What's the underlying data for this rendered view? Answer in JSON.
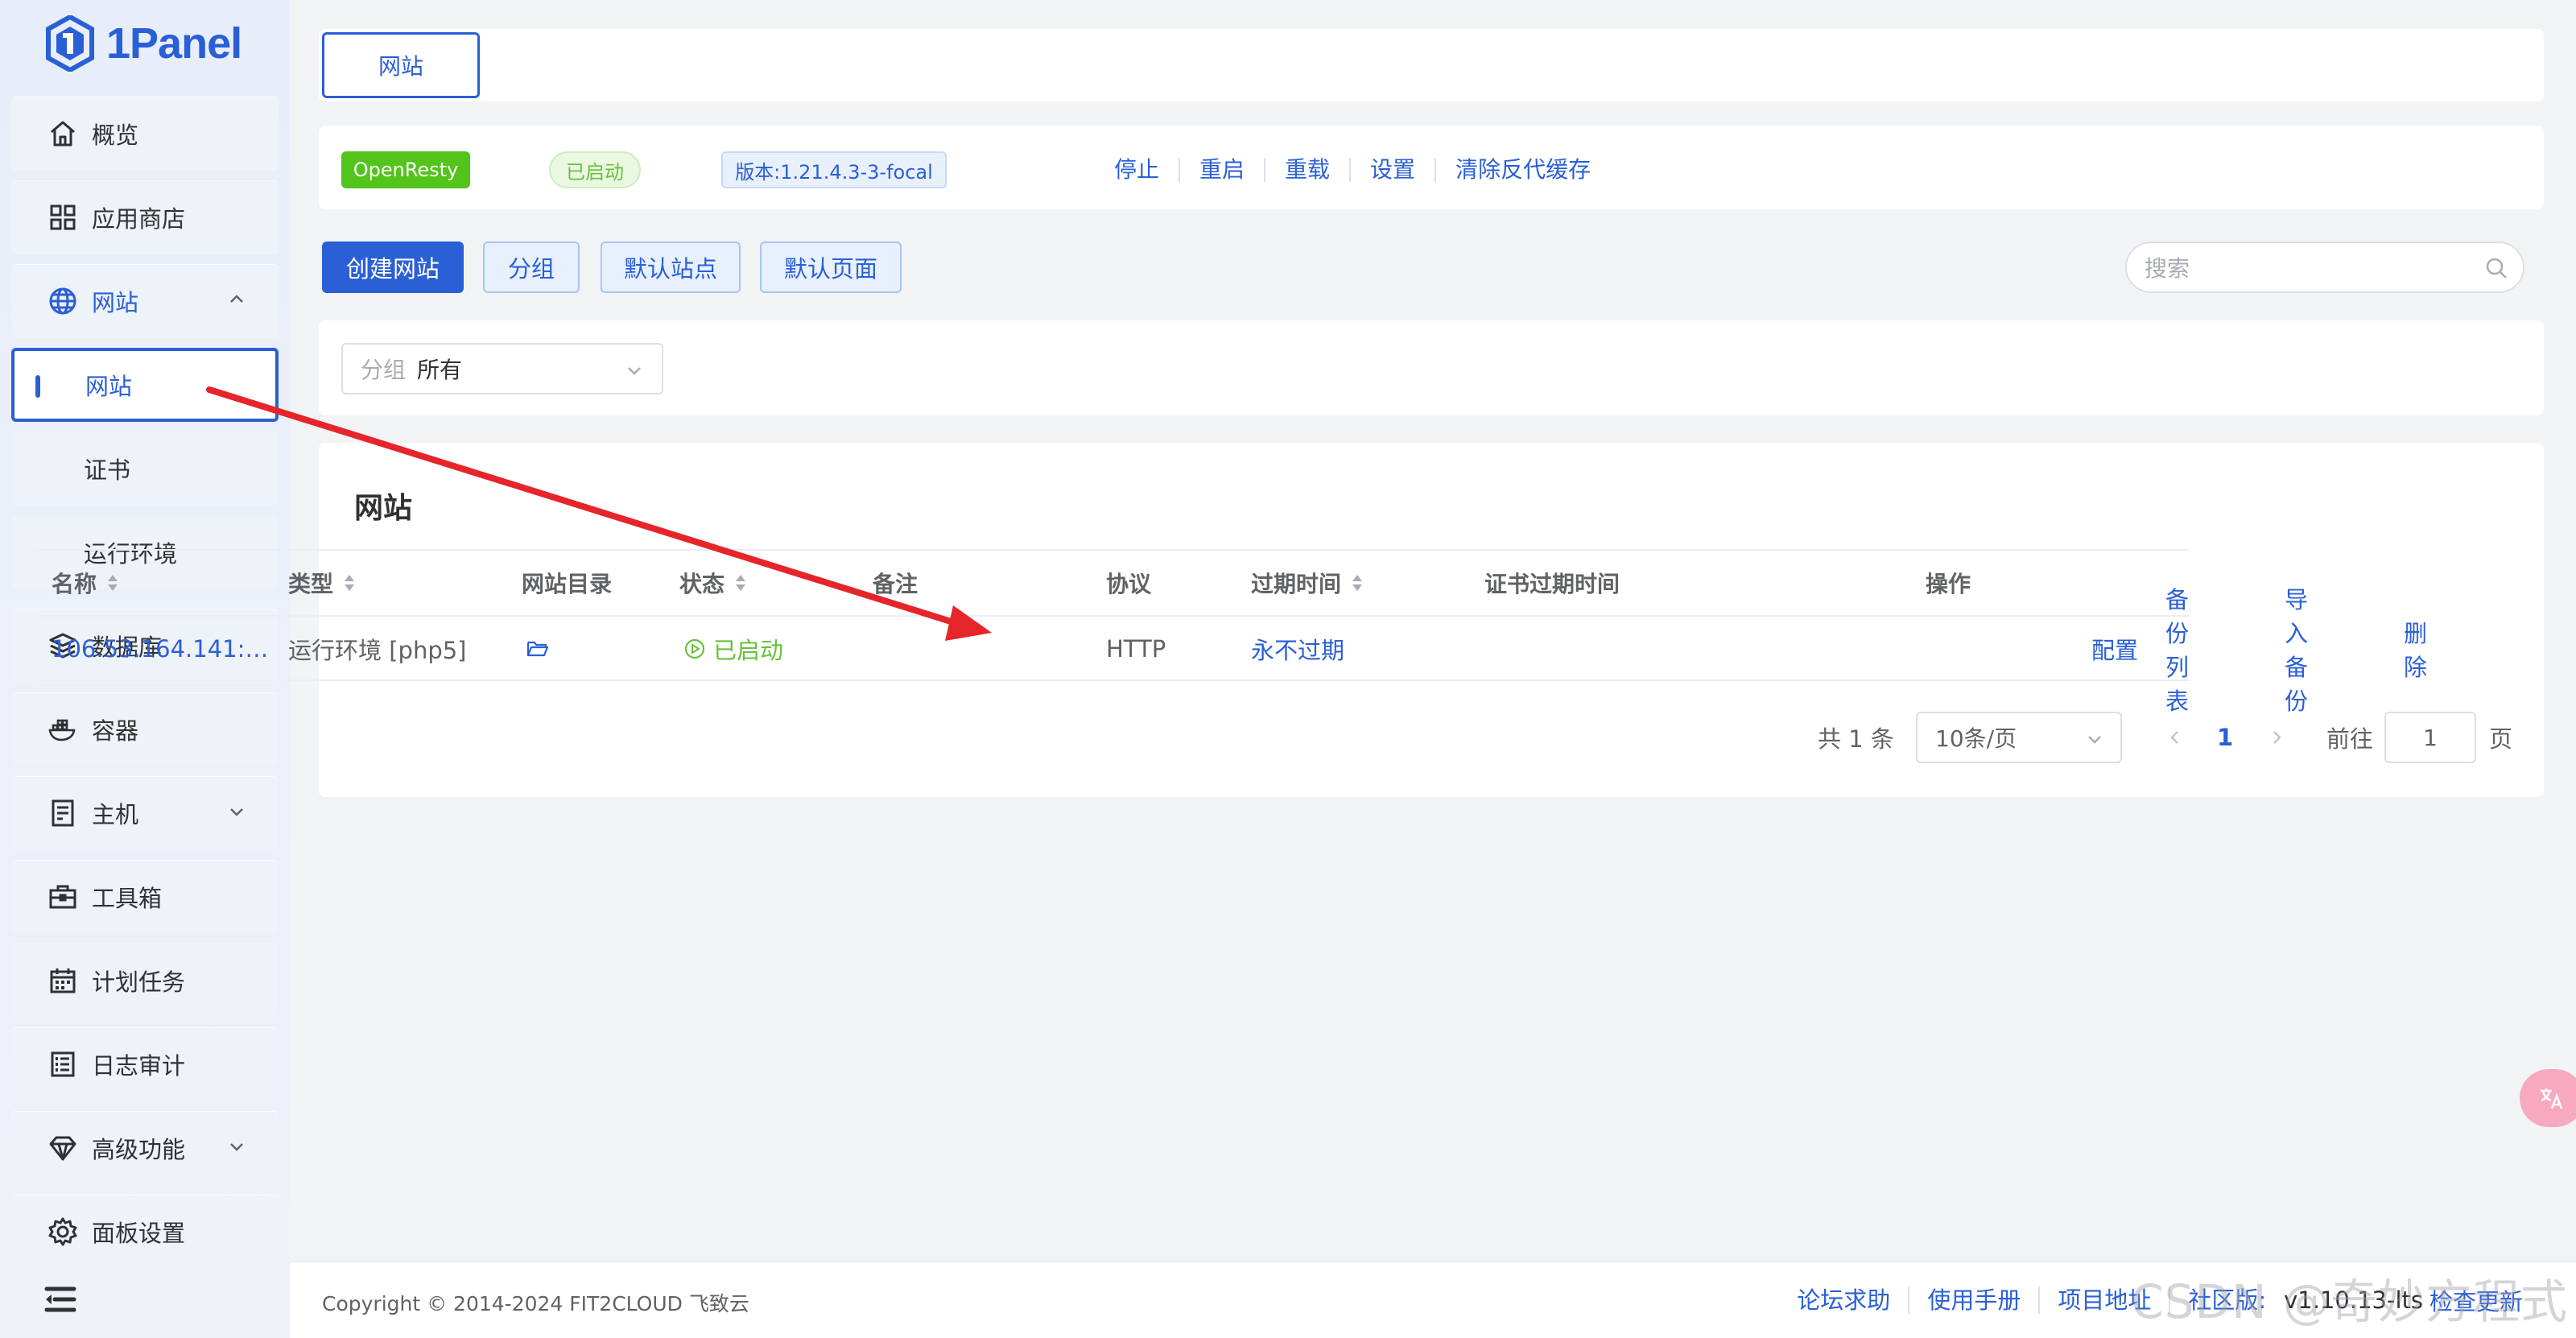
{
  "app": {
    "name": "1Panel"
  },
  "sidebar": {
    "items": [
      {
        "label": "概览",
        "icon": "home-icon"
      },
      {
        "label": "应用商店",
        "icon": "grid-icon"
      },
      {
        "label": "网站",
        "icon": "globe-icon",
        "expanded": true
      },
      {
        "label": "数据库",
        "icon": "layers-icon"
      },
      {
        "label": "容器",
        "icon": "docker-icon"
      },
      {
        "label": "主机",
        "icon": "server-icon"
      },
      {
        "label": "工具箱",
        "icon": "toolbox-icon"
      },
      {
        "label": "计划任务",
        "icon": "calendar-icon"
      },
      {
        "label": "日志审计",
        "icon": "log-icon"
      },
      {
        "label": "高级功能",
        "icon": "diamond-icon"
      },
      {
        "label": "面板设置",
        "icon": "gear-icon"
      }
    ],
    "website_submenu": [
      {
        "label": "网站",
        "active": true
      },
      {
        "label": "证书"
      },
      {
        "label": "运行环境"
      }
    ]
  },
  "tabs": {
    "active": "网站"
  },
  "app_status": {
    "name": "OpenResty",
    "status": "已启动",
    "version": "版本:1.21.4.3-3-focal",
    "actions": [
      "停止",
      "重启",
      "重载",
      "设置",
      "清除反代缓存"
    ]
  },
  "toolbar": {
    "create": "创建网站",
    "group": "分组",
    "default_site": "默认站点",
    "default_page": "默认页面",
    "search_placeholder": "搜索"
  },
  "filter": {
    "group_label": "分组",
    "group_value": "所有"
  },
  "table": {
    "title": "网站",
    "columns": [
      "名称",
      "类型",
      "网站目录",
      "状态",
      "备注",
      "协议",
      "过期时间",
      "证书过期时间",
      "操作"
    ],
    "rows": [
      {
        "name": "106.53.164.141:…",
        "type": "运行环境 [php5]",
        "status": "已启动",
        "remark": "",
        "protocol": "HTTP",
        "expire": "永不过期",
        "cert_expire": "",
        "actions": [
          "配置",
          "备份列表",
          "导入备份",
          "删除"
        ]
      }
    ]
  },
  "pagination": {
    "total": "共 1 条",
    "page_size": "10条/页",
    "current": "1",
    "goto_label": "前往",
    "goto_value": "1",
    "page_suffix": "页"
  },
  "footer": {
    "copyright": "Copyright © 2014-2024 FIT2CLOUD 飞致云",
    "links": [
      "论坛求助",
      "使用手册",
      "项目地址"
    ],
    "edition": "社区版:",
    "version": "v1.10.13-lts",
    "update": "检查更新"
  },
  "watermark": "CSDN @奇妙方程式",
  "colors": {
    "primary": "#2a5fd6",
    "success": "#67c23a",
    "openresty": "#52c41a",
    "arrow": "#e5252a"
  }
}
